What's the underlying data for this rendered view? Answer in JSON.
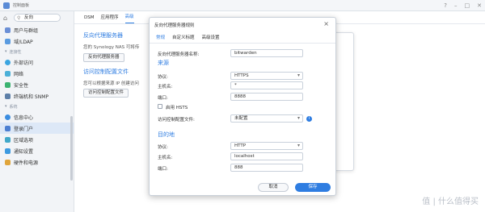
{
  "window": {
    "title": "控制面板",
    "controls": [
      "?",
      "–",
      "□",
      "✕"
    ]
  },
  "sidebar": {
    "search_value": "反向",
    "items": [
      {
        "label": "用户与群组",
        "color": "#6b8fd6"
      },
      {
        "label": "域/LDAP",
        "color": "#5a9be0"
      }
    ],
    "section_connectivity": "连接性",
    "conn_items": [
      {
        "label": "外部访问",
        "color": "#3ba5e0"
      },
      {
        "label": "网络",
        "color": "#4bb0d8"
      },
      {
        "label": "安全性",
        "color": "#3cb371"
      },
      {
        "label": "终端机和 SNMP",
        "color": "#5d7fa8"
      }
    ],
    "section_system": "系统",
    "sys_items": [
      {
        "label": "信息中心",
        "color": "#3b8de0"
      },
      {
        "label": "登录门户",
        "color": "#4c7fd1",
        "active": true
      },
      {
        "label": "区域选项",
        "color": "#41a8c9"
      },
      {
        "label": "通知设置",
        "color": "#3d9ae0"
      },
      {
        "label": "硬件和电源",
        "color": "#e0a53b"
      }
    ]
  },
  "main": {
    "tabs": [
      "DSM",
      "应用程序",
      "高级"
    ],
    "section1_title": "反向代理服务器",
    "section1_desc": "您的 Synology NAS 可将传",
    "section1_button": "反向代理服务器",
    "section2_title": "访问控制配置文件",
    "section2_desc": "您可以根据来源 IP 创建访问",
    "section2_button": "访问控制配置文件"
  },
  "modal": {
    "title": "反向代理服务器规则",
    "tabs": [
      "常规",
      "自定义标题",
      "高级设置"
    ],
    "desc_label": "反向代理服务器名称:",
    "desc_value": "bitwarden",
    "source_title": "来源",
    "src_protocol_label": "协议:",
    "src_protocol_value": "HTTPS",
    "src_host_label": "主机名:",
    "src_host_value": "*",
    "src_port_label": "端口:",
    "src_port_value": "8888",
    "hsts_label": "启用 HSTS",
    "acl_label": "访问控制配置文件:",
    "acl_value": "未配置",
    "dest_title": "目的地",
    "dst_protocol_label": "协议:",
    "dst_protocol_value": "HTTP",
    "dst_host_label": "主机名:",
    "dst_host_value": "localhost",
    "dst_port_label": "端口:",
    "dst_port_value": "888",
    "cancel_label": "取消",
    "save_label": "保存"
  },
  "watermark": "值 | 什么值得买"
}
